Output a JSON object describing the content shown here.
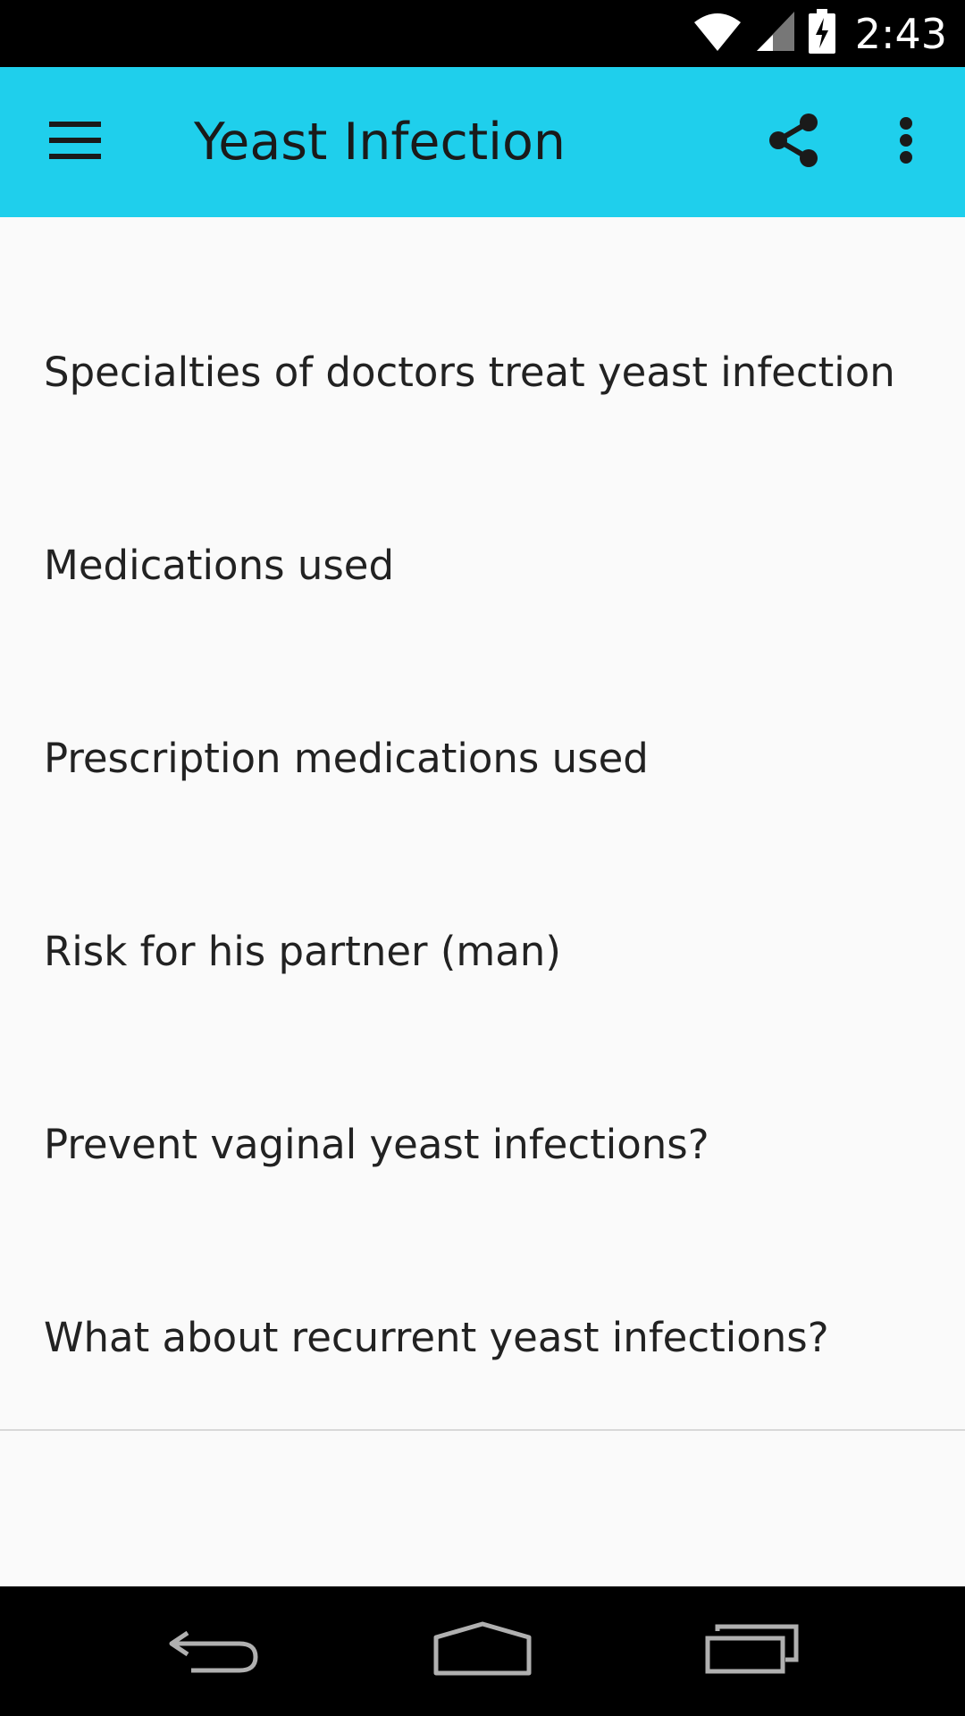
{
  "status_bar": {
    "time": "2:43",
    "icons": [
      "wifi-icon",
      "cell-signal-icon",
      "battery-charging-icon"
    ]
  },
  "app_bar": {
    "title": "Yeast Infection",
    "background_color": "#1fcfec",
    "icons": [
      "menu-icon",
      "share-icon",
      "more-vert-icon"
    ]
  },
  "list": {
    "items": [
      {
        "label": "Specialties of doctors treat yeast infection"
      },
      {
        "label": "Medications used"
      },
      {
        "label": "Prescription medications used"
      },
      {
        "label": "Risk for his partner (man)"
      },
      {
        "label": "Prevent vaginal yeast infections?"
      },
      {
        "label": "What about recurrent yeast infections?"
      }
    ]
  },
  "nav_bar": {
    "icons": [
      "back-icon",
      "home-icon",
      "recents-icon"
    ]
  }
}
